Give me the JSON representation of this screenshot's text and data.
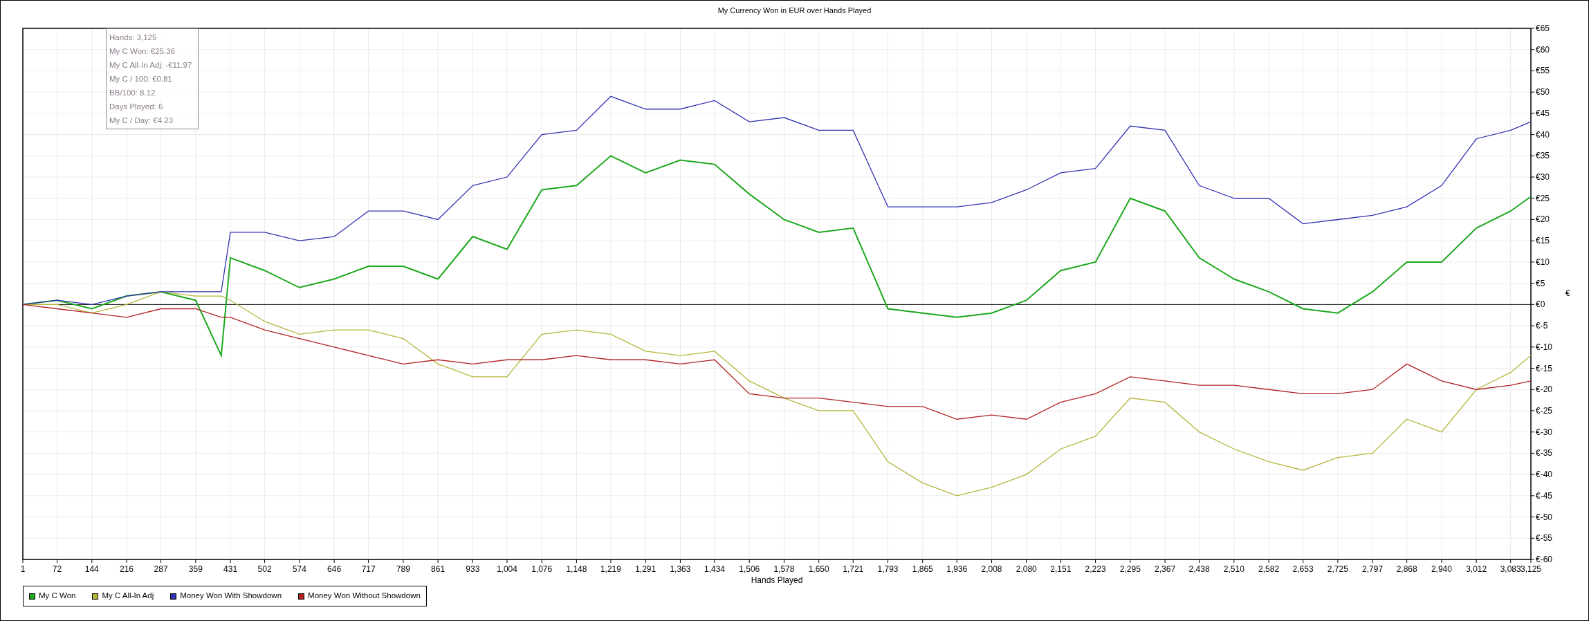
{
  "chart_data": {
    "type": "line",
    "title": "My Currency Won in EUR over Hands Played",
    "xlabel": "Hands Played",
    "ylabel": "€",
    "x": [
      1,
      72,
      144,
      216,
      287,
      359,
      412,
      431,
      502,
      574,
      646,
      717,
      789,
      861,
      933,
      1004,
      1076,
      1148,
      1219,
      1291,
      1363,
      1434,
      1506,
      1578,
      1650,
      1721,
      1793,
      1865,
      1936,
      2008,
      2080,
      2151,
      2223,
      2295,
      2367,
      2438,
      2510,
      2582,
      2653,
      2725,
      2797,
      2868,
      2940,
      3012,
      3083,
      3125
    ],
    "series": [
      {
        "name": "My C Won",
        "color": "#1ca81c",
        "values": [
          0,
          1,
          -1,
          2,
          3,
          1,
          -12,
          11,
          8,
          4,
          6,
          9,
          9,
          6,
          16,
          13,
          27,
          28,
          35,
          31,
          34,
          33,
          26,
          20,
          17,
          18,
          -1,
          -2,
          -3,
          -2,
          1,
          8,
          10,
          25,
          22,
          11,
          6,
          3,
          -1,
          -2,
          3,
          10,
          10,
          18,
          22,
          25.4
        ]
      },
      {
        "name": "My C All-In Adj",
        "color": "#b5b53a",
        "values": [
          0,
          0,
          -2,
          0,
          3,
          2,
          2,
          1,
          -4,
          -7,
          -6,
          -6,
          -8,
          -14,
          -17,
          -17,
          -7,
          -6,
          -7,
          -11,
          -12,
          -11,
          -18,
          -22,
          -25,
          -25,
          -37,
          -42,
          -45,
          -43,
          -40,
          -34,
          -31,
          -22,
          -23,
          -30,
          -34,
          -37,
          -39,
          -36,
          -35,
          -27,
          -30,
          -20,
          -16,
          -12
        ]
      },
      {
        "name": "Money Won With Showdown",
        "color": "#3232b4",
        "values": [
          0,
          1,
          0,
          2,
          3,
          3,
          3,
          17,
          17,
          15,
          16,
          22,
          22,
          20,
          28,
          30,
          40,
          41,
          49,
          46,
          46,
          48,
          43,
          44,
          41,
          41,
          23,
          23,
          23,
          24,
          27,
          31,
          32,
          42,
          41,
          28,
          25,
          25,
          19,
          20,
          21,
          23,
          28,
          39,
          41,
          43
        ]
      },
      {
        "name": "Money Won Without Showdown",
        "color": "#b22222",
        "values": [
          0,
          -1,
          -2,
          -3,
          -1,
          -1,
          -3,
          -3,
          -6,
          -8,
          -10,
          -12,
          -14,
          -13,
          -14,
          -13,
          -13,
          -12,
          -13,
          -13,
          -14,
          -13,
          -21,
          -22,
          -22,
          -23,
          -24,
          -24,
          -27,
          -26,
          -27,
          -23,
          -21,
          -17,
          -18,
          -19,
          -19,
          -20,
          -21,
          -21,
          -20,
          -14,
          -18,
          -20,
          -19,
          -18
        ]
      }
    ],
    "grid": true,
    "xlim": [
      1,
      3125
    ],
    "ylim": [
      -60,
      65
    ],
    "xticks": [
      {
        "value": 1,
        "label": "1"
      },
      {
        "value": 72,
        "label": "72"
      },
      {
        "value": 144,
        "label": "144"
      },
      {
        "value": 216,
        "label": "216"
      },
      {
        "value": 287,
        "label": "287"
      },
      {
        "value": 359,
        "label": "359"
      },
      {
        "value": 431,
        "label": "431"
      },
      {
        "value": 502,
        "label": "502"
      },
      {
        "value": 574,
        "label": "574"
      },
      {
        "value": 646,
        "label": "646"
      },
      {
        "value": 717,
        "label": "717"
      },
      {
        "value": 789,
        "label": "789"
      },
      {
        "value": 861,
        "label": "861"
      },
      {
        "value": 933,
        "label": "933"
      },
      {
        "value": 1004,
        "label": "1,004"
      },
      {
        "value": 1076,
        "label": "1,076"
      },
      {
        "value": 1148,
        "label": "1,148"
      },
      {
        "value": 1219,
        "label": "1,219"
      },
      {
        "value": 1291,
        "label": "1,291"
      },
      {
        "value": 1363,
        "label": "1,363"
      },
      {
        "value": 1434,
        "label": "1,434"
      },
      {
        "value": 1506,
        "label": "1,506"
      },
      {
        "value": 1578,
        "label": "1,578"
      },
      {
        "value": 1650,
        "label": "1,650"
      },
      {
        "value": 1721,
        "label": "1,721"
      },
      {
        "value": 1793,
        "label": "1,793"
      },
      {
        "value": 1865,
        "label": "1,865"
      },
      {
        "value": 1936,
        "label": "1,936"
      },
      {
        "value": 2008,
        "label": "2,008"
      },
      {
        "value": 2080,
        "label": "2,080"
      },
      {
        "value": 2151,
        "label": "2,151"
      },
      {
        "value": 2223,
        "label": "2,223"
      },
      {
        "value": 2295,
        "label": "2,295"
      },
      {
        "value": 2367,
        "label": "2,367"
      },
      {
        "value": 2438,
        "label": "2,438"
      },
      {
        "value": 2510,
        "label": "2,510"
      },
      {
        "value": 2582,
        "label": "2,582"
      },
      {
        "value": 2653,
        "label": "2,653"
      },
      {
        "value": 2725,
        "label": "2,725"
      },
      {
        "value": 2797,
        "label": "2,797"
      },
      {
        "value": 2868,
        "label": "2,868"
      },
      {
        "value": 2940,
        "label": "2,940"
      },
      {
        "value": 3012,
        "label": "3,012"
      },
      {
        "value": 3083,
        "label": "3,083"
      },
      {
        "value": 3125,
        "label": "3,125"
      }
    ],
    "yticks": [
      {
        "value": 65,
        "label": "€65"
      },
      {
        "value": 60,
        "label": "€60"
      },
      {
        "value": 55,
        "label": "€55"
      },
      {
        "value": 50,
        "label": "€50"
      },
      {
        "value": 45,
        "label": "€45"
      },
      {
        "value": 40,
        "label": "€40"
      },
      {
        "value": 35,
        "label": "€35"
      },
      {
        "value": 30,
        "label": "€30"
      },
      {
        "value": 25,
        "label": "€25"
      },
      {
        "value": 20,
        "label": "€20"
      },
      {
        "value": 15,
        "label": "€15"
      },
      {
        "value": 10,
        "label": "€10"
      },
      {
        "value": 5,
        "label": "€5"
      },
      {
        "value": 0,
        "label": "€0"
      },
      {
        "value": -5,
        "label": "€-5"
      },
      {
        "value": -10,
        "label": "€-10"
      },
      {
        "value": -15,
        "label": "€-15"
      },
      {
        "value": -20,
        "label": "€-20"
      },
      {
        "value": -25,
        "label": "€-25"
      },
      {
        "value": -30,
        "label": "€-30"
      },
      {
        "value": -35,
        "label": "€-35"
      },
      {
        "value": -40,
        "label": "€-40"
      },
      {
        "value": -45,
        "label": "€-45"
      },
      {
        "value": -50,
        "label": "€-50"
      },
      {
        "value": -55,
        "label": "€-55"
      },
      {
        "value": -60,
        "label": "€-60"
      }
    ]
  },
  "tooltip": {
    "lines": [
      "Hands: 3,125",
      "My C Won: €25.36",
      "My C All-In Adj: -€11.97",
      "My C / 100: €0.81",
      "BB/100: 8.12",
      "Days Played: 6",
      "My C / Day: €4.23"
    ]
  }
}
